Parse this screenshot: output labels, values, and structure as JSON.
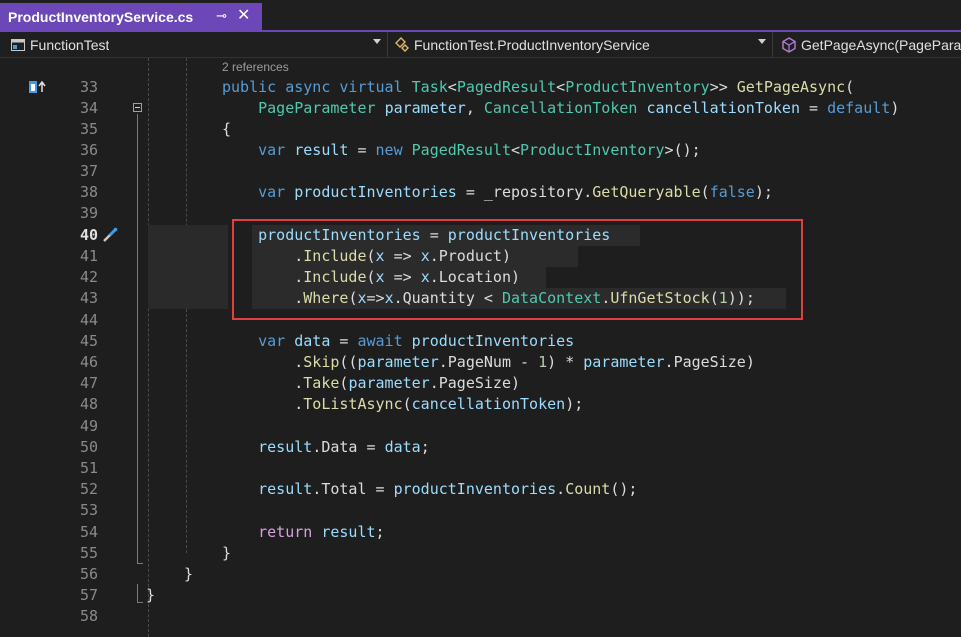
{
  "tab": {
    "title": "ProductInventoryService.cs",
    "pin_icon": "pin-icon",
    "close_icon": "close-icon"
  },
  "nav": {
    "project": "FunctionTest",
    "class": "FunctionTest.ProductInventoryService",
    "member": "GetPageAsync(PageParam"
  },
  "editor": {
    "references_hint": "2 references",
    "current_line": "40",
    "lines": [
      {
        "n": "33",
        "code": "public async virtual Task<PagedResult<ProductInventory>> GetPageAsync("
      },
      {
        "n": "34",
        "code": "    PageParameter parameter, CancellationToken cancellationToken = default)"
      },
      {
        "n": "35",
        "code": "{"
      },
      {
        "n": "36",
        "code": "    var result = new PagedResult<ProductInventory>();"
      },
      {
        "n": "37",
        "code": ""
      },
      {
        "n": "38",
        "code": "    var productInventories = _repository.GetQueryable(false);"
      },
      {
        "n": "39",
        "code": ""
      },
      {
        "n": "40",
        "code": "    productInventories = productInventories"
      },
      {
        "n": "41",
        "code": "        .Include(x => x.Product)"
      },
      {
        "n": "42",
        "code": "        .Include(x => x.Location)"
      },
      {
        "n": "43",
        "code": "        .Where(x=>x.Quantity < DataContext.UfnGetStock(1));"
      },
      {
        "n": "44",
        "code": ""
      },
      {
        "n": "45",
        "code": "    var data = await productInventories"
      },
      {
        "n": "46",
        "code": "        .Skip((parameter.PageNum - 1) * parameter.PageSize)"
      },
      {
        "n": "47",
        "code": "        .Take(parameter.PageSize)"
      },
      {
        "n": "48",
        "code": "        .ToListAsync(cancellationToken);"
      },
      {
        "n": "49",
        "code": ""
      },
      {
        "n": "50",
        "code": "    result.Data = data;"
      },
      {
        "n": "51",
        "code": ""
      },
      {
        "n": "52",
        "code": "    result.Total = productInventories.Count();"
      },
      {
        "n": "53",
        "code": ""
      },
      {
        "n": "54",
        "code": "    return result;"
      },
      {
        "n": "55",
        "code": "}"
      },
      {
        "n": "56",
        "code": "}"
      },
      {
        "n": "57",
        "code": "}"
      },
      {
        "n": "58",
        "code": ""
      }
    ]
  },
  "colors": {
    "accent": "#6c47b8",
    "keyword": "#569cd6",
    "control": "#d8a0df",
    "type": "#4ec9b0",
    "method": "#dcdcaa",
    "variable": "#9cdcfe",
    "number": "#b5cea8",
    "highlight_box": "#e04040"
  }
}
